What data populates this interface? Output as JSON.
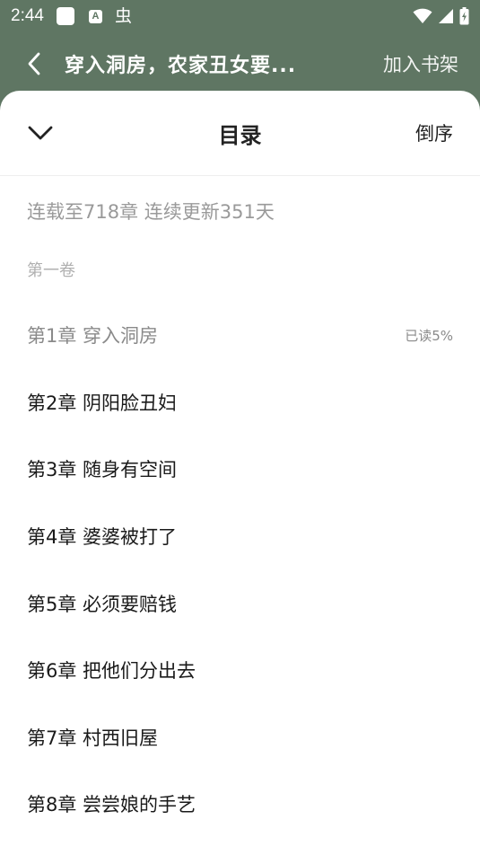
{
  "status_bar": {
    "time": "2:44",
    "a_label": "A",
    "bug_glyph": "虫"
  },
  "app_bar": {
    "title": "穿入洞房，农家丑女要...",
    "add_to_shelf": "加入书架"
  },
  "sheet": {
    "title": "目录",
    "sort_label": "倒序",
    "update_info": "连载至718章 连续更新351天",
    "volume": "第一卷",
    "chapters": [
      {
        "title": "第1章 穿入洞房",
        "progress": "已读5%",
        "read": true
      },
      {
        "title": "第2章 阴阳脸丑妇",
        "progress": "",
        "read": false
      },
      {
        "title": "第3章 随身有空间",
        "progress": "",
        "read": false
      },
      {
        "title": "第4章 婆婆被打了",
        "progress": "",
        "read": false
      },
      {
        "title": "第5章 必须要赔钱",
        "progress": "",
        "read": false
      },
      {
        "title": "第6章 把他们分出去",
        "progress": "",
        "read": false
      },
      {
        "title": "第7章 村西旧屋",
        "progress": "",
        "read": false
      },
      {
        "title": "第8章 尝尝娘的手艺",
        "progress": "",
        "read": false
      }
    ]
  },
  "colors": {
    "header_bg": "#5f7663",
    "sheet_bg": "#ffffff",
    "muted_text": "#9a9a9a"
  }
}
